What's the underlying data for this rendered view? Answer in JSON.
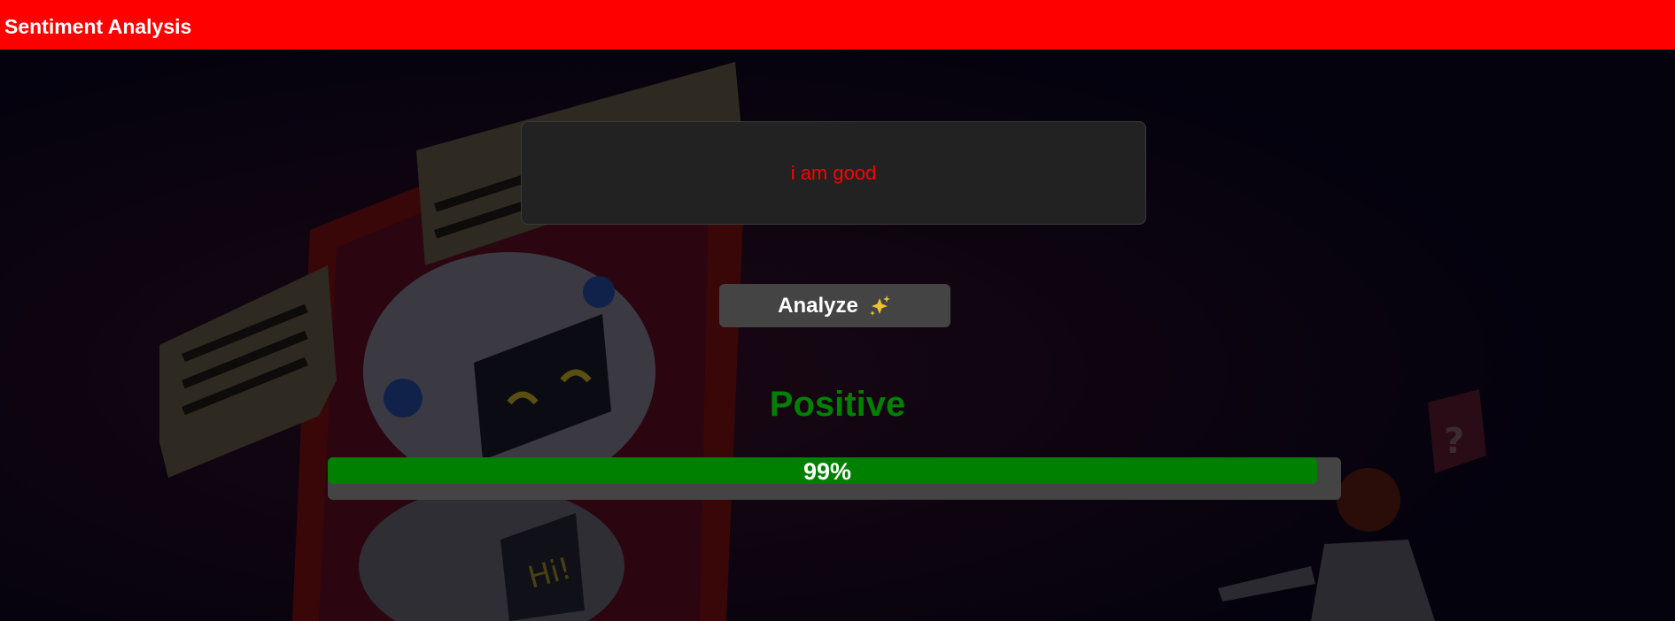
{
  "app": {
    "title": "Sentiment Analysis",
    "header_color": "#ff0000"
  },
  "input": {
    "value": "i am good",
    "text_color": "#ff0000"
  },
  "analyze_button": {
    "label": "Analyze",
    "icon": "sparkles-icon"
  },
  "result": {
    "label": "Positive",
    "color": "#008000",
    "confidence_text": "99%",
    "confidence_fraction": 0.99,
    "bar_color": "#008000"
  },
  "background": {
    "bubble_text": "Hi!",
    "question_mark": "?"
  }
}
